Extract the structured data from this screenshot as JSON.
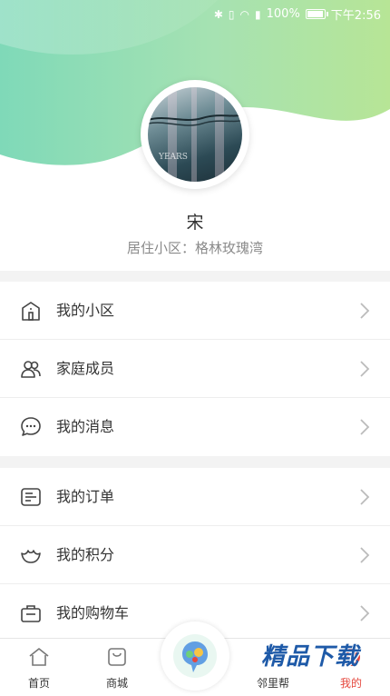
{
  "status_bar": {
    "icons": [
      "bluetooth-icon",
      "vibrate-icon",
      "wifi-icon",
      "sim-icon"
    ],
    "battery_text": "100%",
    "time": "下午2:56"
  },
  "profile": {
    "username": "宋",
    "community": "居住小区：格林玫瑰湾",
    "avatar_text": "YEARS"
  },
  "menu_groups": [
    {
      "items": [
        {
          "label": "我的小区",
          "icon": "house-icon"
        },
        {
          "label": "家庭成员",
          "icon": "people-icon"
        },
        {
          "label": "我的消息",
          "icon": "message-icon"
        }
      ]
    },
    {
      "items": [
        {
          "label": "我的订单",
          "icon": "order-icon"
        },
        {
          "label": "我的积分",
          "icon": "points-icon"
        },
        {
          "label": "我的购物车",
          "icon": "cart-icon"
        }
      ]
    }
  ],
  "tabbar": {
    "tabs": [
      {
        "label": "首页",
        "icon": "home-icon"
      },
      {
        "label": "商城",
        "icon": "shop-icon"
      },
      {
        "label": "",
        "icon": "center-logo-icon"
      },
      {
        "label": "邻里帮",
        "icon": "neighbor-icon"
      },
      {
        "label": "我的",
        "icon": "profile-icon",
        "active": true
      }
    ]
  },
  "watermark": {
    "text": "精品下载"
  },
  "colors": {
    "brand_green_light": "#8fdcb8",
    "brand_green_mid": "#a8e0a0",
    "active_tab": "#e5473d",
    "text_primary": "#333333",
    "text_secondary": "#8a8a8a"
  }
}
